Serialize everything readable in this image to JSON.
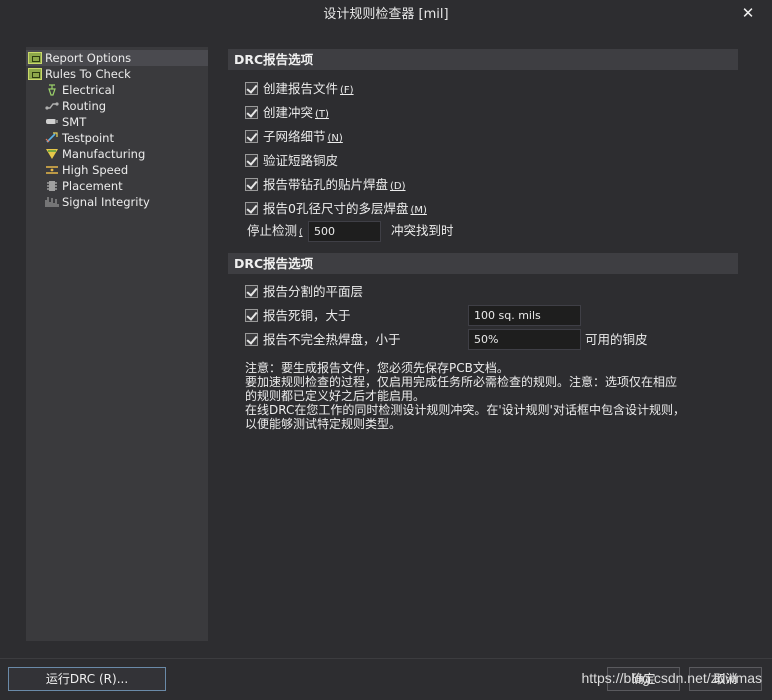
{
  "window": {
    "title": "设计规则检查器 [mil]",
    "close_glyph": "✕"
  },
  "tree": {
    "items": [
      {
        "label": "Report Options",
        "icon": "rules-icon",
        "selected": true
      },
      {
        "label": "Rules To Check",
        "icon": "rules-icon"
      },
      {
        "label": "Electrical",
        "icon": "electrical-icon"
      },
      {
        "label": "Routing",
        "icon": "routing-icon"
      },
      {
        "label": "SMT",
        "icon": "smt-icon"
      },
      {
        "label": "Testpoint",
        "icon": "testpoint-icon"
      },
      {
        "label": "Manufacturing",
        "icon": "manufacturing-icon"
      },
      {
        "label": "High Speed",
        "icon": "high-speed-icon"
      },
      {
        "label": "Placement",
        "icon": "placement-icon"
      },
      {
        "label": "Signal Integrity",
        "icon": "signal-integrity-icon"
      }
    ]
  },
  "section1": {
    "header": "DRC报告选项",
    "checks": [
      {
        "label": "创建报告文件",
        "hotkey": "(F)"
      },
      {
        "label": "创建冲突",
        "hotkey": "(T)"
      },
      {
        "label": "子网络细节",
        "hotkey": "(N)"
      },
      {
        "label": "验证短路铜皮",
        "hotkey": ""
      },
      {
        "label": "报告带钻孔的贴片焊盘",
        "hotkey": "(D)"
      },
      {
        "label": "报告0孔径尺寸的多层焊盘",
        "hotkey": "(M)"
      }
    ],
    "stop_label": "停止检测",
    "stop_hotkey": "(",
    "stop_value": "500",
    "stop_suffix": "冲突找到时"
  },
  "section2": {
    "header": "DRC报告选项",
    "checks": [
      {
        "label": "报告分割的平面层"
      },
      {
        "label": "报告死铜，大于",
        "value": "100 sq. mils"
      },
      {
        "label": "报告不完全热焊盘，小于",
        "value": "50%",
        "suffix": "可用的铜皮"
      }
    ]
  },
  "note": {
    "lines": [
      "注意：要生成报告文件，您必须先保存PCB文档。",
      "要加速规则检查的过程，仅启用完成任务所必需检查的规则。注意：选项仅在相应",
      "的规则都已定义好之后才能启用。",
      "在线DRC在您工作的同时检测设计规则冲突。在'设计规则'对话框中包含设计规则，",
      "以便能够测试特定规则类型。"
    ]
  },
  "buttons": {
    "run": "运行DRC (R)...",
    "ok": "确定",
    "cancel": "取消"
  },
  "watermark": "https://blog.csdn.net/zdwmas"
}
